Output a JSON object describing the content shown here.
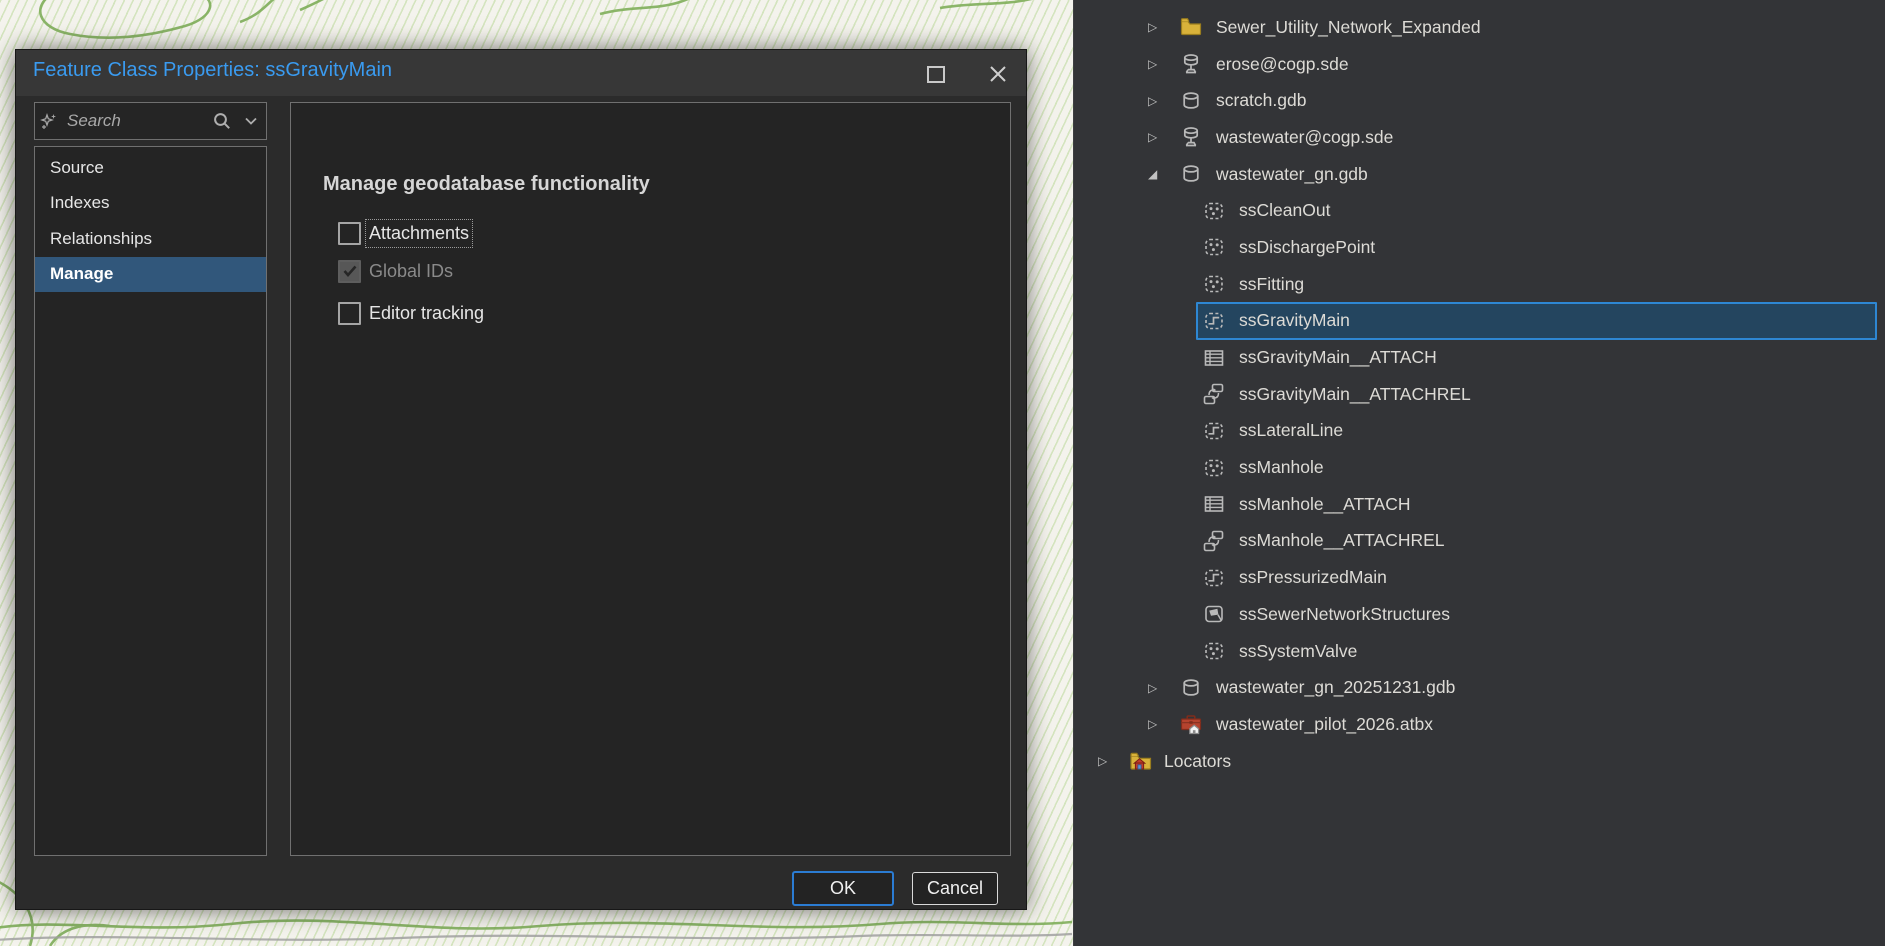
{
  "window": {
    "title": "Feature Class Properties: ssGravityMain",
    "controls": {
      "maximize": "maximize",
      "close": "close"
    }
  },
  "dialog": {
    "search": {
      "placeholder": "Search"
    },
    "sidebar": {
      "items": [
        {
          "label": "Source",
          "selected": false
        },
        {
          "label": "Indexes",
          "selected": false
        },
        {
          "label": "Relationships",
          "selected": false
        },
        {
          "label": "Manage",
          "selected": true
        }
      ]
    },
    "content": {
      "heading": "Manage geodatabase functionality",
      "checkboxes": [
        {
          "label": "Attachments",
          "checked": false,
          "disabled": false,
          "focused": true
        },
        {
          "label": "Global IDs",
          "checked": true,
          "disabled": true,
          "focused": false
        },
        {
          "label": "Editor tracking",
          "checked": false,
          "disabled": false,
          "focused": false
        }
      ]
    },
    "buttons": {
      "ok": "OK",
      "cancel": "Cancel"
    }
  },
  "catalog_tree": {
    "items": [
      {
        "label": "Sewer_Utility_Network_Expanded",
        "icon": "folder-icon",
        "level": 1,
        "expander": "collapsed",
        "selected": false
      },
      {
        "label": "erose@cogp.sde",
        "icon": "database-connection-icon",
        "level": 1,
        "expander": "collapsed",
        "selected": false
      },
      {
        "label": "scratch.gdb",
        "icon": "geodatabase-icon",
        "level": 1,
        "expander": "collapsed",
        "selected": false
      },
      {
        "label": "wastewater@cogp.sde",
        "icon": "database-connection-icon",
        "level": 1,
        "expander": "collapsed",
        "selected": false
      },
      {
        "label": "wastewater_gn.gdb",
        "icon": "geodatabase-icon",
        "level": 1,
        "expander": "expanded",
        "selected": false
      },
      {
        "label": "ssCleanOut",
        "icon": "point-feature-class-icon",
        "level": 2,
        "expander": "none",
        "selected": false
      },
      {
        "label": "ssDischargePoint",
        "icon": "point-feature-class-icon",
        "level": 2,
        "expander": "none",
        "selected": false
      },
      {
        "label": "ssFitting",
        "icon": "point-feature-class-icon",
        "level": 2,
        "expander": "none",
        "selected": false
      },
      {
        "label": "ssGravityMain",
        "icon": "line-feature-class-icon",
        "level": 2,
        "expander": "none",
        "selected": true
      },
      {
        "label": "ssGravityMain__ATTACH",
        "icon": "table-icon",
        "level": 2,
        "expander": "none",
        "selected": false
      },
      {
        "label": "ssGravityMain__ATTACHREL",
        "icon": "relationship-class-icon",
        "level": 2,
        "expander": "none",
        "selected": false
      },
      {
        "label": "ssLateralLine",
        "icon": "line-feature-class-icon",
        "level": 2,
        "expander": "none",
        "selected": false
      },
      {
        "label": "ssManhole",
        "icon": "point-feature-class-icon",
        "level": 2,
        "expander": "none",
        "selected": false
      },
      {
        "label": "ssManhole__ATTACH",
        "icon": "table-icon",
        "level": 2,
        "expander": "none",
        "selected": false
      },
      {
        "label": "ssManhole__ATTACHREL",
        "icon": "relationship-class-icon",
        "level": 2,
        "expander": "none",
        "selected": false
      },
      {
        "label": "ssPressurizedMain",
        "icon": "line-feature-class-icon",
        "level": 2,
        "expander": "none",
        "selected": false
      },
      {
        "label": "ssSewerNetworkStructures",
        "icon": "polygon-feature-class-icon",
        "level": 2,
        "expander": "none",
        "selected": false
      },
      {
        "label": "ssSystemValve",
        "icon": "point-feature-class-icon",
        "level": 2,
        "expander": "none",
        "selected": false
      },
      {
        "label": "wastewater_gn_20251231.gdb",
        "icon": "geodatabase-icon",
        "level": 1,
        "expander": "collapsed",
        "selected": false
      },
      {
        "label": "wastewater_pilot_2026.atbx",
        "icon": "toolbox-icon",
        "level": 1,
        "expander": "collapsed",
        "selected": false
      },
      {
        "label": "Locators",
        "icon": "locators-folder-icon",
        "level": 0,
        "expander": "collapsed",
        "selected": false
      }
    ]
  },
  "colors": {
    "accent_blue": "#2E87D3",
    "selection_fill": "#24455F",
    "title_blue": "#3A9BF0",
    "manage_selected": "#31577B",
    "ok_border": "#2B7CD3",
    "folder_yellow": "#D9B23A",
    "toolbox_red": "#B5432E",
    "tree_text": "#DDDBD6",
    "map_green": "#7FAE5A"
  }
}
